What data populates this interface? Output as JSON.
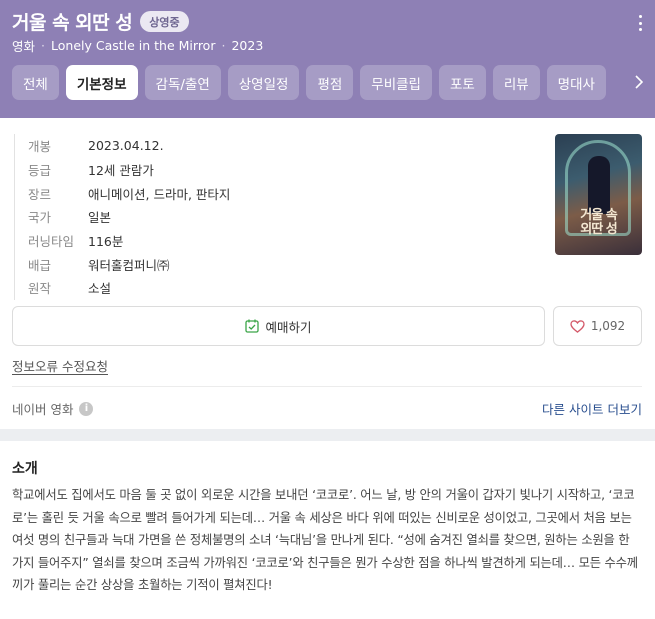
{
  "header": {
    "title": "거울 속 외딴 성",
    "badge": "상영중",
    "category": "영화",
    "original_title": "Lonely Castle in the Mirror",
    "year": "2023",
    "separator": "·",
    "bg_color": "#8e80b5"
  },
  "tabs": [
    {
      "label": "전체",
      "active": false
    },
    {
      "label": "기본정보",
      "active": true
    },
    {
      "label": "감독/출연",
      "active": false
    },
    {
      "label": "상영일정",
      "active": false
    },
    {
      "label": "평점",
      "active": false
    },
    {
      "label": "무비클립",
      "active": false
    },
    {
      "label": "포토",
      "active": false
    },
    {
      "label": "리뷰",
      "active": false
    },
    {
      "label": "명대사",
      "active": false
    }
  ],
  "tab_next_icon": "chevron-right-icon",
  "info": [
    {
      "key": "개봉",
      "value": "2023.04.12."
    },
    {
      "key": "등급",
      "value": "12세 관람가"
    },
    {
      "key": "장르",
      "value": "애니메이션, 드라마, 판타지"
    },
    {
      "key": "국가",
      "value": "일본"
    },
    {
      "key": "러닝타임",
      "value": "116분"
    },
    {
      "key": "배급",
      "value": "워터홀컴퍼니㈜"
    },
    {
      "key": "원작",
      "value": "소설"
    }
  ],
  "poster": {
    "text_line1": "거울 속",
    "text_line2": "외딴 성"
  },
  "actions": {
    "reserve_label": "예매하기",
    "like_count": "1,092",
    "accent_green": "#3aa547",
    "heart_color": "#d45a6a"
  },
  "report_link": "정보오류 수정요청",
  "source": {
    "label": "네이버 영화",
    "info_icon": "i",
    "other_sites": "다른 사이트 더보기"
  },
  "intro": {
    "title": "소개",
    "text": "학교에서도 집에서도 마음 둘 곳 없이 외로운 시간을 보내던 ‘코코로’. 어느 날, 방 안의 거울이 갑자기 빛나기 시작하고, ‘코코로’는 홀린 듯 거울 속으로 빨려 들어가게 되는데… 거울 속 세상은 바다 위에 떠있는 신비로운 성이었고, 그곳에서 처음 보는 여섯 명의 친구들과 늑대 가면을 쓴 정체불명의 소녀 ‘늑대님’을 만나게 된다. “성에 숨겨진 열쇠를 찾으면, 원하는 소원을 한 가지 들어주지” 열쇠를 찾으며 조금씩 가까워진 ‘코코로’와 친구들은 뭔가 수상한 점을 하나씩 발견하게 되는데… 모든 수수께끼가 풀리는 순간 상상을 초월하는 기적이 펼쳐진다!"
  }
}
